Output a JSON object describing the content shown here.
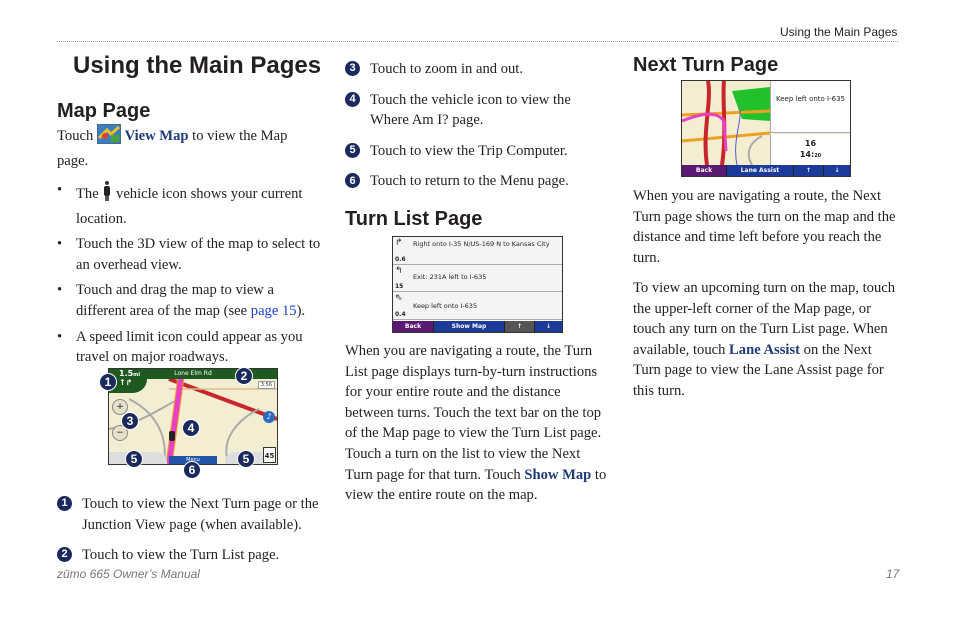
{
  "header": {
    "running_title": "Using the Main Pages"
  },
  "page_title": "Using the Main Pages",
  "map_page": {
    "heading": "Map Page",
    "intro_before": "Touch",
    "intro_link": "View Map",
    "intro_after": "to view the Map page.",
    "bullets": [
      {
        "before": "The",
        "after": "vehicle icon shows your current location."
      },
      {
        "text": "Touch the 3D view of the map to select to an overhead view."
      },
      {
        "before": "Touch and drag the map to view a different area of the map (see",
        "link": "page 15",
        "after": ")."
      },
      {
        "text": "A speed limit icon could appear as you travel on major roadways."
      }
    ],
    "screenshot": {
      "street": "Lone Elm Rd",
      "distance": "1.5",
      "distance_unit": "mi",
      "time": "3:56",
      "menu_label": "Menu",
      "speed_limit": "45",
      "markers": [
        "1",
        "2",
        "3",
        "4",
        "5",
        "5",
        "6"
      ]
    },
    "callouts": [
      {
        "num": "1",
        "text": "Touch to view the Next Turn page or the Junction View page (when available)."
      },
      {
        "num": "2",
        "text": "Touch to view the Turn List page."
      },
      {
        "num": "3",
        "text": "Touch to zoom in and out."
      },
      {
        "num": "4",
        "text": "Touch the vehicle icon to view the Where Am I? page."
      },
      {
        "num": "5",
        "text": "Touch to view the Trip Computer."
      },
      {
        "num": "6",
        "text": "Touch to return to the Menu page."
      }
    ]
  },
  "turn_list_page": {
    "heading": "Turn List Page",
    "screenshot": {
      "turns": [
        {
          "instruction": "Right onto I-35 N/US-169 N to Kansas City",
          "distance": "0.6"
        },
        {
          "instruction": "Exit: 231A left to I-635",
          "distance": "15"
        },
        {
          "instruction": "Keep left onto I-635",
          "distance": "0.4"
        }
      ],
      "back_label": "Back",
      "show_map_label": "Show Map"
    },
    "para_before": "When you are navigating a route, the Turn List page displays turn-by-turn instructions for your entire route and the distance between turns. Touch the text bar on the top of the Map page to view the Turn List page. Touch a turn on the list to view the Next Turn page for that turn. Touch",
    "para_link": "Show Map",
    "para_after": "to view the entire route on the map."
  },
  "next_turn_page": {
    "heading": "Next Turn Page",
    "screenshot": {
      "instruction": "Keep left onto I-635",
      "distance": "16",
      "time_h": "14",
      "time_m": "20",
      "back_label": "Back",
      "lane_assist_label": "Lane Assist"
    },
    "para1": "When you are navigating a route, the Next Turn page shows the turn on the map and the distance and time left before you reach the turn.",
    "para2_before": "To view an upcoming turn on the map, touch the upper-left corner of the Map page, or touch any turn on the Turn List page. When available, touch",
    "para2_link": "Lane Assist",
    "para2_after": "on the Next Turn page to view the Lane Assist page for this turn."
  },
  "footer": {
    "manual_title": "zūmo 665 Owner’s Manual",
    "page_number": "17"
  }
}
